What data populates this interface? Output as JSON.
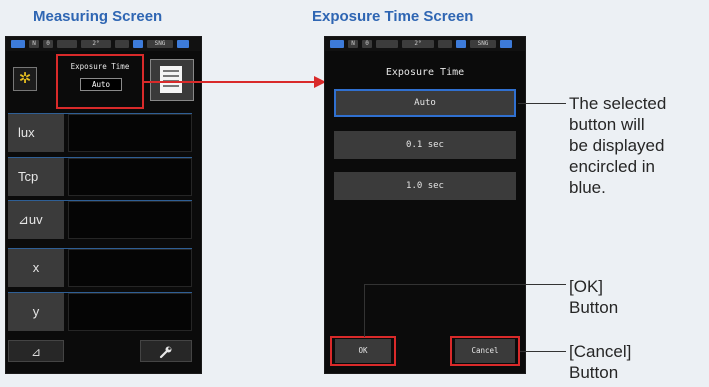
{
  "titles": {
    "measuring": "Measuring Screen",
    "exposure": "Exposure Time Screen"
  },
  "statusbar": {
    "cells": [
      "N",
      "0",
      "",
      "2°",
      "",
      "",
      "SNG",
      ""
    ]
  },
  "measuring": {
    "exposure_label": "Exposure Time",
    "exposure_value": "Auto",
    "rows": [
      "lux",
      "Tcp",
      "⊿uv",
      "x",
      "y"
    ],
    "bottom_left_icon": "delta-icon",
    "bottom_left_symbol": "⊿",
    "bottom_right_icon": "wrench-icon"
  },
  "exposure_screen": {
    "heading": "Exposure Time",
    "options": [
      "Auto",
      "0.1 sec",
      "1.0 sec"
    ],
    "selected": "Auto",
    "ok_label": "OK",
    "cancel_label": "Cancel"
  },
  "annotations": {
    "selected_note": [
      "The selected",
      "button will",
      "be displayed",
      "encircled in",
      "blue."
    ],
    "ok_note": [
      "[OK]",
      "Button"
    ],
    "cancel_note": [
      "[Cancel]",
      "Button"
    ]
  },
  "colors": {
    "highlight_red": "#d92a2a",
    "select_blue": "#3070d0",
    "title_blue": "#2f66b3"
  }
}
